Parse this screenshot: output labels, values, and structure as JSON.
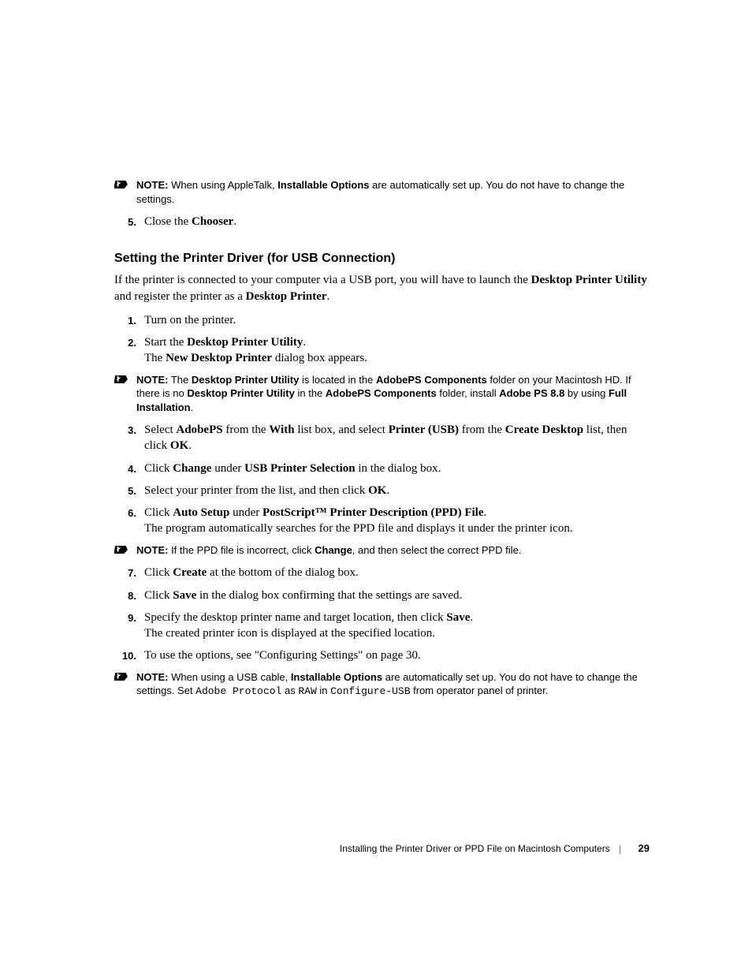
{
  "note1": {
    "label": "NOTE:",
    "pre": " When using AppleTalk, ",
    "bold1": "Installable Options",
    "post": " are automatically set up. You do not have to change the settings."
  },
  "step5a": {
    "num": "5.",
    "t1": "Close the ",
    "b1": "Chooser",
    "t2": "."
  },
  "heading": "Setting the Printer Driver (for USB Connection)",
  "intro": {
    "t1": "If the printer is connected to your computer via a USB port, you will have to launch the ",
    "b1": "Desktop Printer Utility",
    "t2": " and register the printer as a ",
    "b2": "Desktop Printer",
    "t3": "."
  },
  "s1": {
    "num": "1.",
    "t1": "Turn on the printer."
  },
  "s2": {
    "num": "2.",
    "t1": "Start the ",
    "b1": "Desktop Printer Utility",
    "t2": ".",
    "line2a": "The ",
    "line2b": "New Desktop Printer",
    "line2c": " dialog box appears."
  },
  "note2": {
    "label": "NOTE:",
    "t1": " The ",
    "b1": "Desktop Printer Utility",
    "t2": " is located in the ",
    "b2": "AdobePS Components",
    "t3": " folder on your Macintosh HD. If there is no ",
    "b3": "Desktop Printer Utility",
    "t4": " in the ",
    "b4": "AdobePS Components",
    "t5": " folder, install ",
    "b5": "Adobe PS 8.8",
    "t6": " by using ",
    "b6": "Full Installation",
    "t7": "."
  },
  "s3": {
    "num": "3.",
    "t1": "Select ",
    "b1": "AdobePS",
    "t2": " from the ",
    "b2": "With",
    "t3": " list box, and select ",
    "b3": "Printer (USB)",
    "t4": " from the ",
    "b4": "Create Desktop",
    "t5": " list, then click ",
    "b5": "OK",
    "t6": "."
  },
  "s4": {
    "num": "4.",
    "t1": "Click ",
    "b1": "Change",
    "t2": " under ",
    "b2": "USB Printer Selection",
    "t3": " in the dialog box."
  },
  "s5": {
    "num": "5.",
    "t1": "Select your printer from the list, and then click ",
    "b1": "OK",
    "t2": "."
  },
  "s6": {
    "num": "6.",
    "t1": "Click ",
    "b1": "Auto Setup",
    "t2": " under ",
    "b2": "PostScript™ Printer Description (PPD) File",
    "t3": ".",
    "line2": "The program automatically searches for the PPD file and displays it under the printer icon."
  },
  "note3": {
    "label": "NOTE:",
    "t1": " If the PPD file is incorrect, click ",
    "b1": "Change",
    "t2": ", and then select the correct PPD file."
  },
  "s7": {
    "num": "7.",
    "t1": "Click ",
    "b1": "Create",
    "t2": " at the bottom of the dialog box."
  },
  "s8": {
    "num": "8.",
    "t1": "Click ",
    "b1": "Save",
    "t2": " in the dialog box confirming that the settings are saved."
  },
  "s9": {
    "num": "9.",
    "t1": "Specify the desktop printer name and target location, then click ",
    "b1": "Save",
    "t2": ".",
    "line2": "The created printer icon is displayed at the specified location."
  },
  "s10": {
    "num": "10.",
    "t1": "To use the options, see \"Configuring Settings\" on page 30."
  },
  "note4": {
    "label": "NOTE:",
    "t1": " When using a USB cable, ",
    "b1": "Installable Options",
    "t2": " are automatically set up. You do not have to change the settings. Set ",
    "m1": "Adobe Protocol",
    "t3": " as ",
    "m2": "RAW",
    "t4": " in ",
    "m3": "Configure-USB",
    "t5": " from operator panel of printer."
  },
  "footer": {
    "title": "Installing the Printer Driver or PPD File on Macintosh Computers",
    "page": "29"
  }
}
